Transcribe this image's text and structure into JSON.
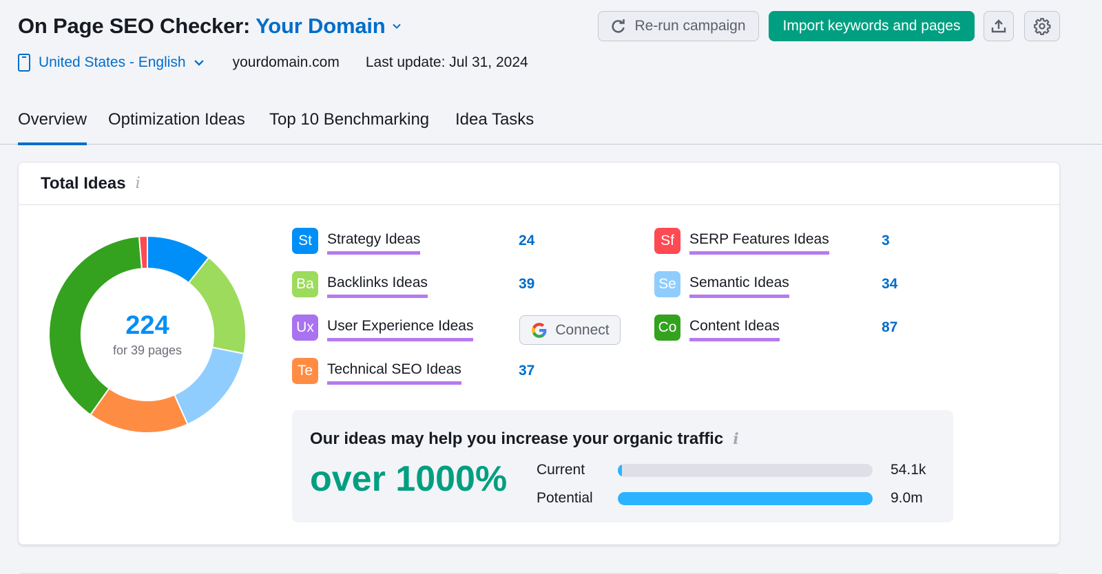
{
  "header": {
    "title_prefix": "On Page SEO Checker:",
    "project_name": "Your Domain",
    "database": "United States - English",
    "domain": "yourdomain.com",
    "last_update": "Last update: Jul 31, 2024"
  },
  "toolbar": {
    "rerun_label": "Re-run campaign",
    "import_label": "Import keywords and pages",
    "export_icon": "upload-icon",
    "settings_icon": "gear-icon"
  },
  "tabs": [
    {
      "label": "Overview",
      "active": true
    },
    {
      "label": "Optimization Ideas",
      "active": false
    },
    {
      "label": "Top 10 Benchmarking",
      "active": false
    },
    {
      "label": "Idea Tasks",
      "active": false
    }
  ],
  "total_ideas": {
    "title": "Total Ideas",
    "total": "224",
    "subtitle": "for 39 pages",
    "connect_label": "Connect",
    "ideas": [
      {
        "abbr": "St",
        "label": "Strategy Ideas",
        "count": "24",
        "color": "#008ff8"
      },
      {
        "abbr": "Ba",
        "label": "Backlinks Ideas",
        "count": "39",
        "color": "#9cdb5c"
      },
      {
        "abbr": "Ux",
        "label": "User Experience Ideas",
        "count": null,
        "color": "#a972f0"
      },
      {
        "abbr": "Te",
        "label": "Technical SEO Ideas",
        "count": "37",
        "color": "#ff8c43"
      },
      {
        "abbr": "Sf",
        "label": "SERP Features Ideas",
        "count": "3",
        "color": "#ff4953"
      },
      {
        "abbr": "Se",
        "label": "Semantic Ideas",
        "count": "34",
        "color": "#8fcdff"
      },
      {
        "abbr": "Co",
        "label": "Content Ideas",
        "count": "87",
        "color": "#34a21f"
      }
    ]
  },
  "chart_data": {
    "type": "pie",
    "title": "Total Ideas",
    "center_label": "224",
    "center_sublabel": "for 39 pages",
    "categories": [
      "Strategy Ideas",
      "Backlinks Ideas",
      "Semantic Ideas",
      "Technical SEO Ideas",
      "Content Ideas",
      "SERP Features Ideas"
    ],
    "values": [
      24,
      39,
      34,
      37,
      87,
      3
    ],
    "colors": [
      "#008ff8",
      "#9cdb5c",
      "#8fcdff",
      "#ff8c43",
      "#34a21f",
      "#ff4953"
    ]
  },
  "traffic": {
    "title": "Our ideas may help you increase your organic traffic",
    "growth": "over 1000%",
    "rows": [
      {
        "label": "Current",
        "value": "54.1k",
        "fill_fraction": 0.006
      },
      {
        "label": "Potential",
        "value": "9.0m",
        "fill_fraction": 1.0
      }
    ]
  }
}
